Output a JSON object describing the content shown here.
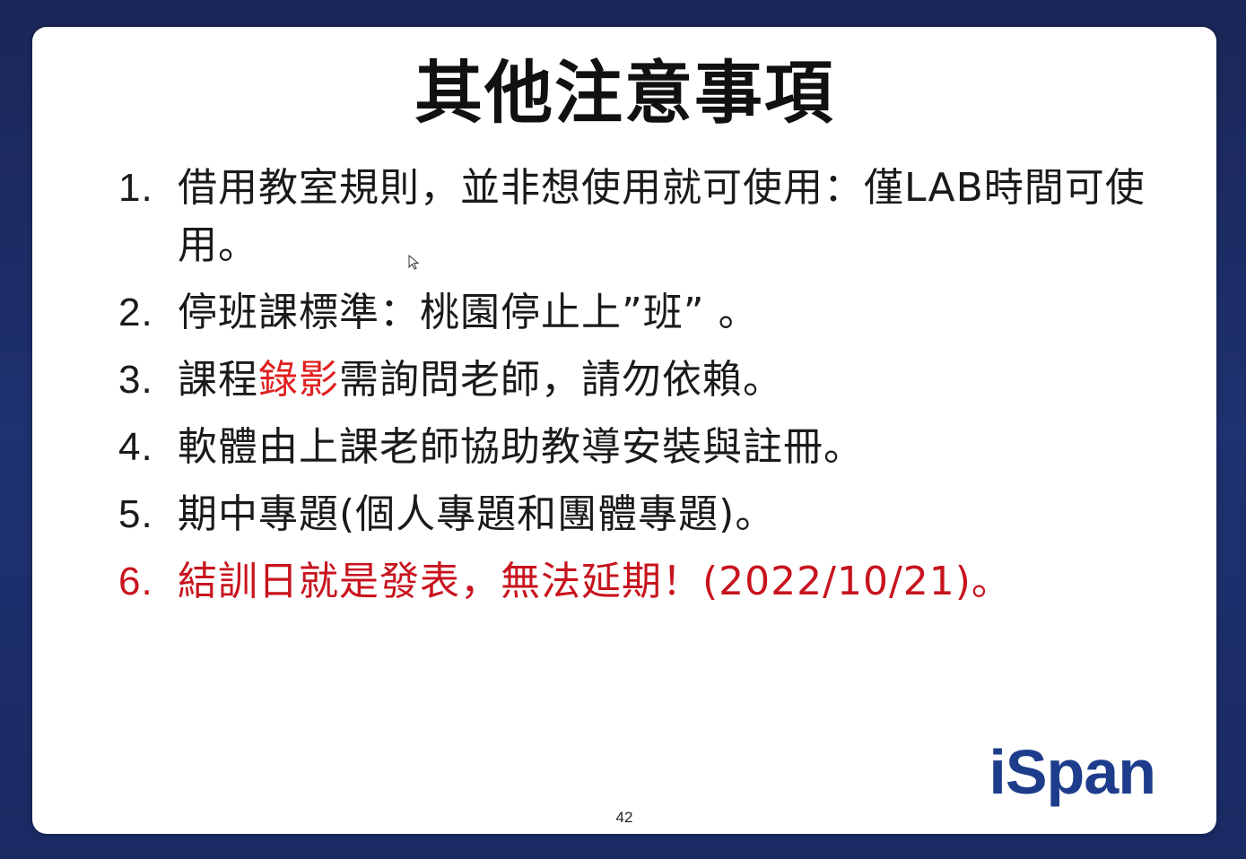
{
  "slide": {
    "title": "其他注意事項",
    "items": [
      {
        "num": "1.",
        "text": "借用教室規則，並非想使用就可使用：僅LAB時間可使用。"
      },
      {
        "num": "2.",
        "text": "停班課標準：桃園停止上”班” 。"
      },
      {
        "num": "3.",
        "text_before": "課程",
        "text_red": "錄影",
        "text_after": "需詢問老師，請勿依賴。"
      },
      {
        "num": "4.",
        "text": "軟體由上課老師協助教導安裝與註冊。"
      },
      {
        "num": "5.",
        "text": "期中專題(個人專題和團體專題)。"
      },
      {
        "num": "6.",
        "text": "結訓日就是發表，無法延期！(2022/10/21)。"
      }
    ],
    "page_number": "42",
    "logo": "iSpan"
  },
  "colors": {
    "background": "#1b2a5e",
    "slide_bg": "#ffffff",
    "text": "#1a1a1a",
    "highlight_red": "#e02020",
    "logo_blue": "#1d3d8c"
  }
}
